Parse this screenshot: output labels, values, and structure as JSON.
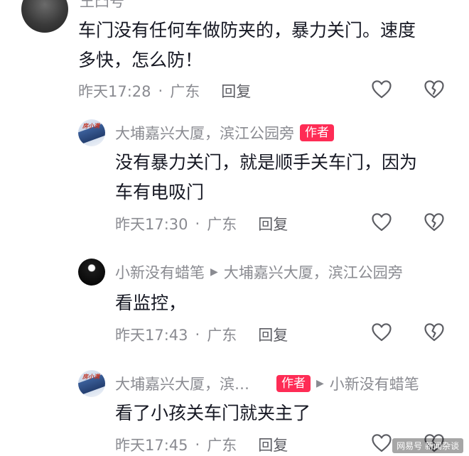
{
  "comments": [
    {
      "nickname": "王凸号",
      "text_lines": [
        "车门没有任何车做防夹的，暴力关门。速度",
        "多快，怎么防！"
      ],
      "time": "昨天17:28",
      "sep": "·",
      "location": "广东",
      "reply": "回复"
    },
    {
      "nickname": "大埔嘉兴大厦，滨江公园旁",
      "badge": "作者",
      "avatar_tag": "房小满",
      "text_lines": [
        "没有暴力关门，就是顺手关车门，因为",
        "车有电吸门"
      ],
      "time": "昨天17:30",
      "sep": "·",
      "location": "广东",
      "reply": "回复"
    },
    {
      "nickname": "小新没有蜡笔",
      "reply_to": "大埔嘉兴大厦，滨江公园旁",
      "text_lines": [
        "看监控，"
      ],
      "time": "昨天17:43",
      "sep": "·",
      "location": "广东",
      "reply": "回复"
    },
    {
      "nickname": "大埔嘉兴大厦，滨…",
      "badge": "作者",
      "avatar_tag": "房小满",
      "reply_to": "小新没有蜡笔",
      "text_lines": [
        "看了小孩关车门就夹主了"
      ],
      "time": "昨天17:45",
      "sep": "·",
      "location": "广东",
      "reply": "回复"
    }
  ],
  "watermark": "网易号 新闻杂谈",
  "icons": {
    "like": "heart-icon",
    "dislike": "broken-heart-icon",
    "reply_arrow": "triangle-right-icon"
  },
  "colors": {
    "badge": "#fe2c55",
    "meta": "#8a8b91",
    "text": "#161823"
  }
}
